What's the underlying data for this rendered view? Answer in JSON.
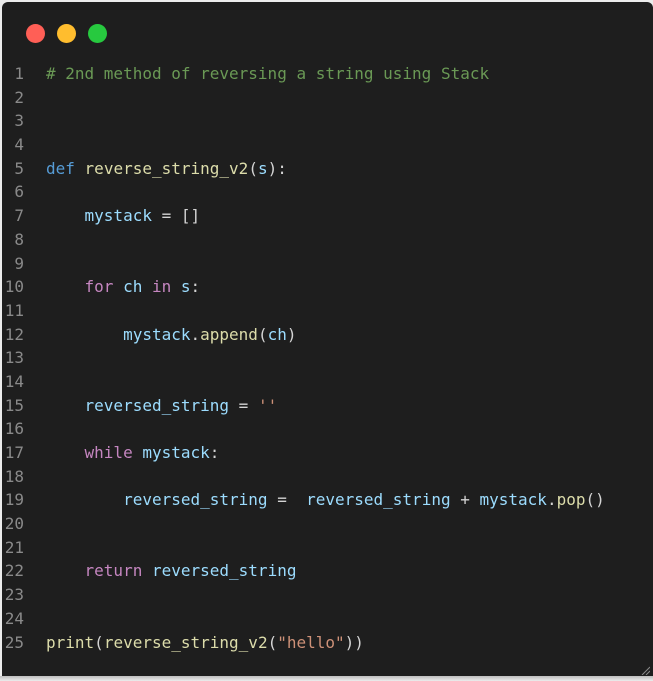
{
  "window": {
    "controls": [
      {
        "name": "close",
        "color": "#ff5f56"
      },
      {
        "name": "minimize",
        "color": "#ffbd2e"
      },
      {
        "name": "maximize",
        "color": "#27c93f"
      }
    ]
  },
  "code": {
    "lines": [
      {
        "n": "1",
        "tokens": [
          {
            "t": "# 2nd method of reversing a string using Stack",
            "c": "c-comment"
          }
        ]
      },
      {
        "n": "2",
        "tokens": []
      },
      {
        "n": "3",
        "tokens": []
      },
      {
        "n": "4",
        "tokens": []
      },
      {
        "n": "5",
        "tokens": [
          {
            "t": "def",
            "c": "c-kw"
          },
          {
            "t": " ",
            "c": "c-plain"
          },
          {
            "t": "reverse_string_v2",
            "c": "c-fn"
          },
          {
            "t": "(",
            "c": "c-plain"
          },
          {
            "t": "s",
            "c": "c-var"
          },
          {
            "t": "):",
            "c": "c-plain"
          }
        ]
      },
      {
        "n": "6",
        "tokens": []
      },
      {
        "n": "7",
        "tokens": [
          {
            "t": "    ",
            "c": "c-plain"
          },
          {
            "t": "mystack",
            "c": "c-var"
          },
          {
            "t": " = []",
            "c": "c-plain"
          }
        ]
      },
      {
        "n": "8",
        "tokens": []
      },
      {
        "n": "9",
        "tokens": []
      },
      {
        "n": "10",
        "tokens": [
          {
            "t": "    ",
            "c": "c-plain"
          },
          {
            "t": "for",
            "c": "c-ctrl"
          },
          {
            "t": " ",
            "c": "c-plain"
          },
          {
            "t": "ch",
            "c": "c-var"
          },
          {
            "t": " ",
            "c": "c-plain"
          },
          {
            "t": "in",
            "c": "c-ctrl"
          },
          {
            "t": " ",
            "c": "c-plain"
          },
          {
            "t": "s",
            "c": "c-var"
          },
          {
            "t": ":",
            "c": "c-plain"
          }
        ]
      },
      {
        "n": "11",
        "tokens": []
      },
      {
        "n": "12",
        "tokens": [
          {
            "t": "        ",
            "c": "c-plain"
          },
          {
            "t": "mystack",
            "c": "c-var"
          },
          {
            "t": ".",
            "c": "c-plain"
          },
          {
            "t": "append",
            "c": "c-fn"
          },
          {
            "t": "(",
            "c": "c-plain"
          },
          {
            "t": "ch",
            "c": "c-var"
          },
          {
            "t": ")",
            "c": "c-plain"
          }
        ]
      },
      {
        "n": "13",
        "tokens": []
      },
      {
        "n": "14",
        "tokens": []
      },
      {
        "n": "15",
        "tokens": [
          {
            "t": "    ",
            "c": "c-plain"
          },
          {
            "t": "reversed_string",
            "c": "c-var"
          },
          {
            "t": " = ",
            "c": "c-plain"
          },
          {
            "t": "''",
            "c": "c-str"
          }
        ]
      },
      {
        "n": "16",
        "tokens": []
      },
      {
        "n": "17",
        "tokens": [
          {
            "t": "    ",
            "c": "c-plain"
          },
          {
            "t": "while",
            "c": "c-ctrl"
          },
          {
            "t": " ",
            "c": "c-plain"
          },
          {
            "t": "mystack",
            "c": "c-var"
          },
          {
            "t": ":",
            "c": "c-plain"
          }
        ]
      },
      {
        "n": "18",
        "tokens": []
      },
      {
        "n": "19",
        "tokens": [
          {
            "t": "        ",
            "c": "c-plain"
          },
          {
            "t": "reversed_string",
            "c": "c-var"
          },
          {
            "t": " =  ",
            "c": "c-plain"
          },
          {
            "t": "reversed_string",
            "c": "c-var"
          },
          {
            "t": " + ",
            "c": "c-plain"
          },
          {
            "t": "mystack",
            "c": "c-var"
          },
          {
            "t": ".",
            "c": "c-plain"
          },
          {
            "t": "pop",
            "c": "c-fn"
          },
          {
            "t": "()",
            "c": "c-plain"
          }
        ]
      },
      {
        "n": "20",
        "tokens": []
      },
      {
        "n": "21",
        "tokens": []
      },
      {
        "n": "22",
        "tokens": [
          {
            "t": "    ",
            "c": "c-plain"
          },
          {
            "t": "return",
            "c": "c-ctrl"
          },
          {
            "t": " ",
            "c": "c-plain"
          },
          {
            "t": "reversed_string",
            "c": "c-var"
          }
        ]
      },
      {
        "n": "23",
        "tokens": []
      },
      {
        "n": "24",
        "tokens": []
      },
      {
        "n": "25",
        "tokens": [
          {
            "t": "print",
            "c": "c-fn"
          },
          {
            "t": "(",
            "c": "c-plain"
          },
          {
            "t": "reverse_string_v2",
            "c": "c-fn"
          },
          {
            "t": "(",
            "c": "c-plain"
          },
          {
            "t": "\"hello\"",
            "c": "c-str"
          },
          {
            "t": "))",
            "c": "c-plain"
          }
        ]
      }
    ]
  }
}
